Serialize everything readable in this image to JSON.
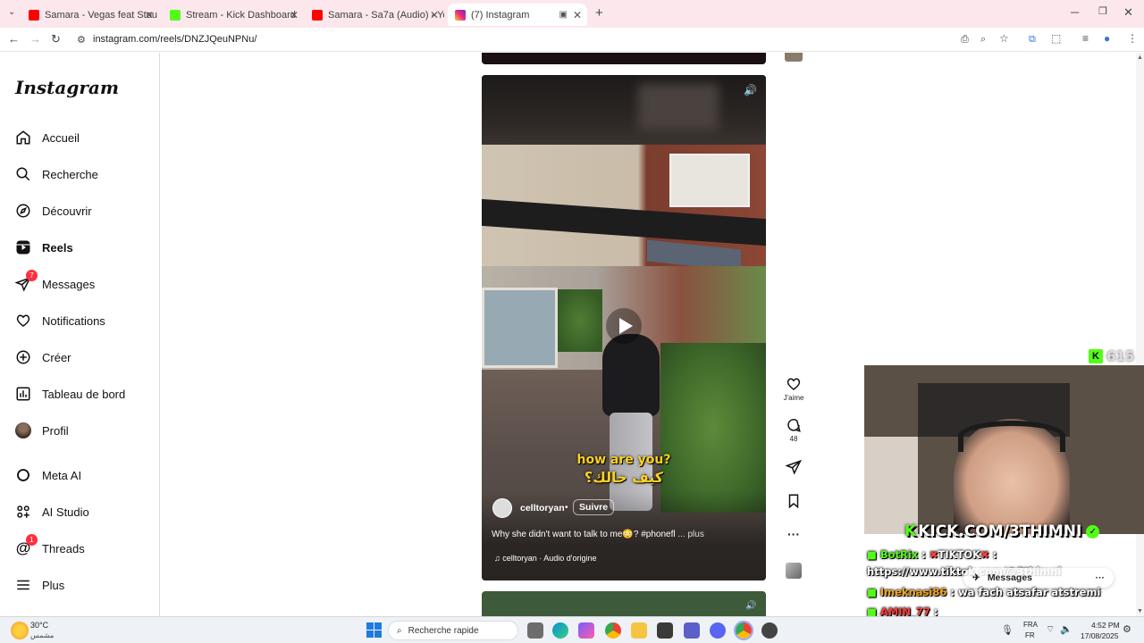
{
  "browser": {
    "tabs": [
      {
        "label": "Samara - Vegas feat Stou (Audi",
        "icon": "youtube-icon",
        "color": "#ff0000"
      },
      {
        "label": "Stream - Kick Dashboard",
        "icon": "kick-icon",
        "color": "#53fc18"
      },
      {
        "label": "Samara - Sa7a (Audio) - YouTul",
        "icon": "youtube-icon",
        "color": "#ff0000"
      },
      {
        "label": "(7) Instagram",
        "icon": "instagram-icon",
        "color": "#d6249f"
      }
    ],
    "url": "instagram.com/reels/DNZJQeuNPNu/"
  },
  "sidebar": {
    "logo": "Instagram",
    "items": [
      {
        "label": "Accueil",
        "icon": "home-icon"
      },
      {
        "label": "Recherche",
        "icon": "search-icon"
      },
      {
        "label": "Découvrir",
        "icon": "compass-icon"
      },
      {
        "label": "Reels",
        "icon": "reels-icon"
      },
      {
        "label": "Messages",
        "icon": "messenger-icon",
        "badge": "7"
      },
      {
        "label": "Notifications",
        "icon": "heart-icon"
      },
      {
        "label": "Créer",
        "icon": "plus-square-icon"
      },
      {
        "label": "Tableau de bord",
        "icon": "bar-chart-icon"
      },
      {
        "label": "Profil",
        "icon": "avatar-icon"
      },
      {
        "label": "Meta AI",
        "icon": "meta-ai-icon"
      },
      {
        "label": "AI Studio",
        "icon": "ai-studio-icon"
      },
      {
        "label": "Threads",
        "icon": "threads-icon",
        "badge": "1"
      },
      {
        "label": "Plus",
        "icon": "menu-icon"
      }
    ]
  },
  "reel": {
    "caption_en": "how are you?",
    "caption_ar": "كيف حالك؟",
    "username": "celltoryan",
    "follow": "Suivre",
    "description": "Why she didn't want to talk to me😳? #phonefl",
    "more": "... plus",
    "audio": "celltoryan · Audio d'origine",
    "likes_label": "J'aime",
    "comments": "48"
  },
  "overlay": {
    "viewer_count": "615",
    "banner": "KICK.COM/3THIMNI",
    "messages_label": "Messages",
    "chat": [
      {
        "user": "BotRix",
        "text": "TIKTOK",
        "user_color": "#53fc18"
      },
      {
        "user": "",
        "text": "https://www.tiktok.com/@3thimni",
        "user_color": "#ffffff"
      },
      {
        "user": "Imeknasi86",
        "text": "wa fach atsafar atstremi",
        "user_color": "#f5a623"
      },
      {
        "user": "AMIN_77",
        "text": "",
        "user_color": "#ff3b3b"
      },
      {
        "user": "AMIN_77",
        "text": "",
        "user_color": "#ff3b3b"
      }
    ]
  },
  "taskbar": {
    "weather_temp": "30°C",
    "weather_text": "مشمس",
    "search_label": "Recherche rapide",
    "lang_top": "FRA",
    "lang_bottom": "FR",
    "time": "4:52 PM",
    "date": "17/08/2025"
  }
}
